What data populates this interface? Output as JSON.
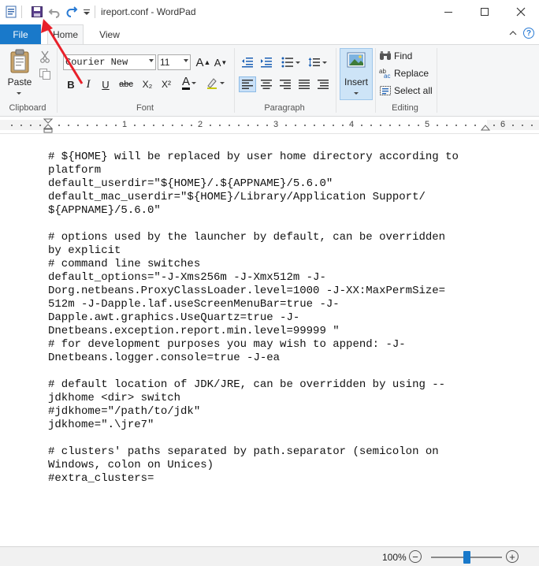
{
  "window": {
    "title": "ireport.conf - WordPad"
  },
  "tabs": {
    "file": "File",
    "home": "Home",
    "view": "View"
  },
  "clipboard": {
    "paste_label": "Paste",
    "group_label": "Clipboard"
  },
  "font": {
    "family": "Courier New",
    "size": "11",
    "group_label": "Font",
    "bold": "B",
    "italic": "I",
    "underline": "U",
    "strike": "abc",
    "subscript": "X₂",
    "superscript": "X²",
    "grow": "A",
    "shrink": "A",
    "color": "A"
  },
  "paragraph": {
    "group_label": "Paragraph"
  },
  "insert": {
    "label": "Insert"
  },
  "editing": {
    "find": "Find",
    "replace": "Replace",
    "select_all": "Select all",
    "group_label": "Editing"
  },
  "ruler": {
    "numbers": [
      "1",
      "2",
      "3",
      "4",
      "5",
      "6"
    ]
  },
  "document": {
    "content": "# ${HOME} will be replaced by user home directory according to\nplatform\ndefault_userdir=\"${HOME}/.${APPNAME}/5.6.0\"\ndefault_mac_userdir=\"${HOME}/Library/Application Support/\n${APPNAME}/5.6.0\"\n\n# options used by the launcher by default, can be overridden\nby explicit\n# command line switches\ndefault_options=\"-J-Xms256m -J-Xmx512m -J-\nDorg.netbeans.ProxyClassLoader.level=1000 -J-XX:MaxPermSize=\n512m -J-Dapple.laf.useScreenMenuBar=true -J-\nDapple.awt.graphics.UseQuartz=true -J-\nDnetbeans.exception.report.min.level=99999 \"\n# for development purposes you may wish to append: -J-\nDnetbeans.logger.console=true -J-ea\n\n# default location of JDK/JRE, can be overridden by using --\njdkhome <dir> switch\n#jdkhome=\"/path/to/jdk\"\njdkhome=\".\\jre7\"\n\n# clusters' paths separated by path.separator (semicolon on\nWindows, colon on Unices)\n#extra_clusters="
  },
  "status": {
    "zoom": "100%",
    "zoom_minus": "−",
    "zoom_plus": "+",
    "zoom_fraction": 0.5
  },
  "colors": {
    "accent": "#1979ca",
    "annotation_arrow": "#e8202a"
  }
}
